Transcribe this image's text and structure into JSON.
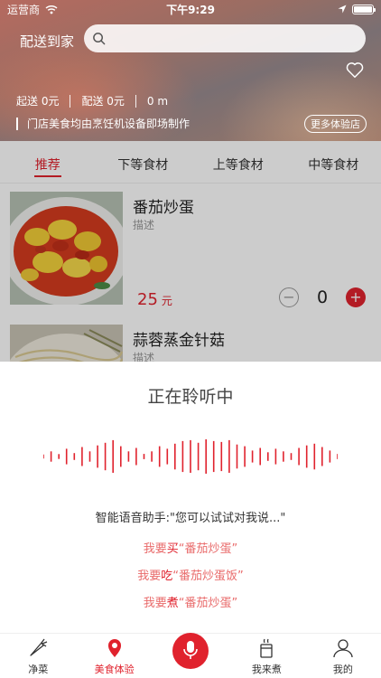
{
  "status_bar": {
    "carrier": "运营商",
    "time": "下午9:29"
  },
  "header": {
    "delivery_label": "配送到家",
    "search_placeholder": "",
    "info": {
      "min_order": "起送 0元",
      "delivery_fee": "配送 0元",
      "distance": "0 m"
    },
    "notice": "门店美食均由烹饪机设备即场制作",
    "more_stores": "更多体验店"
  },
  "tabs": [
    {
      "label": "推荐",
      "active": true
    },
    {
      "label": "下等食材",
      "active": false
    },
    {
      "label": "上等食材",
      "active": false
    },
    {
      "label": "中等食材",
      "active": false
    }
  ],
  "items": [
    {
      "name": "番茄炒蛋",
      "desc": "描述",
      "price": "25",
      "unit": "元",
      "count": "0",
      "image": "tomato-egg-photo"
    },
    {
      "name": "蒜蓉蒸金针菇",
      "desc": "描述",
      "image": "enoki-photo"
    }
  ],
  "voice": {
    "title": "正在聆听中",
    "assistant": "智能语音助手:\"您可以试试对我说...\"",
    "wave_levels": [
      0.12,
      0.3,
      0.14,
      0.45,
      0.2,
      0.55,
      0.3,
      0.65,
      0.8,
      0.95,
      0.6,
      0.3,
      0.5,
      0.15,
      0.3,
      0.6,
      0.45,
      0.75,
      0.9,
      0.95,
      0.8,
      1.0,
      0.9,
      0.85,
      0.95,
      0.7,
      0.6,
      0.35,
      0.5,
      0.25,
      0.45,
      0.3,
      0.2,
      0.5,
      0.65,
      0.75,
      0.55,
      0.35,
      0.15
    ],
    "suggestions": [
      {
        "pre": "我要",
        "verb": "买",
        "dish": "“番茄炒蛋”"
      },
      {
        "pre": "我要",
        "verb": "吃",
        "dish": "“番茄炒蛋饭”"
      },
      {
        "pre": "我要",
        "verb": "煮",
        "dish": "“番茄炒蛋”"
      }
    ]
  },
  "nav": {
    "items": [
      {
        "label": "净菜",
        "icon": "carrot-icon"
      },
      {
        "label": "美食体验",
        "icon": "location-food-icon",
        "active": true
      },
      {
        "label": "",
        "icon": "microphone-icon"
      },
      {
        "label": "我来煮",
        "icon": "cooker-icon"
      },
      {
        "label": "我的",
        "icon": "user-icon"
      }
    ]
  },
  "colors": {
    "accent": "#e0222d",
    "suggest": "#e96b6b"
  }
}
